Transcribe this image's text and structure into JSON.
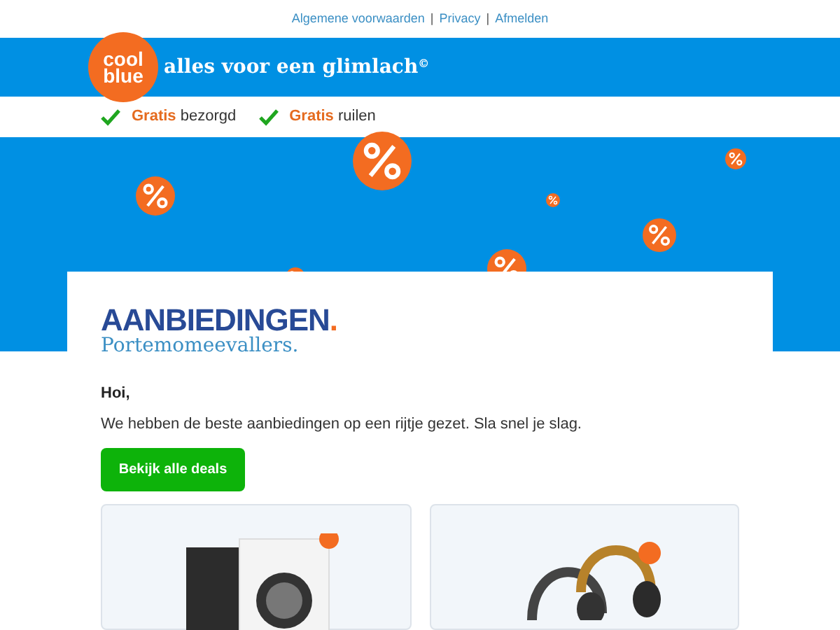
{
  "top_links": [
    "Algemene voorwaarden",
    "Privacy",
    "Afmelden"
  ],
  "separator": "|",
  "header": {
    "logo": [
      "cool",
      "blue"
    ],
    "tagline": "alles voor een glimlach",
    "tagline_mark": "©"
  },
  "usps": [
    {
      "highlight": "Gratis",
      "text": "bezorgd"
    },
    {
      "highlight": "Gratis",
      "text": "ruilen"
    }
  ],
  "card": {
    "title": "AANBIEDINGEN",
    "title_dot": ".",
    "subtitle": "Portemomeevallers.",
    "greeting": "Hoi,",
    "intro": "We hebben de beste aanbiedingen op een rijtje gezet. Sla snel je slag.",
    "button": "Bekijk alle deals"
  },
  "products": [
    {
      "kind": "washer"
    },
    {
      "kind": "headphones"
    }
  ]
}
